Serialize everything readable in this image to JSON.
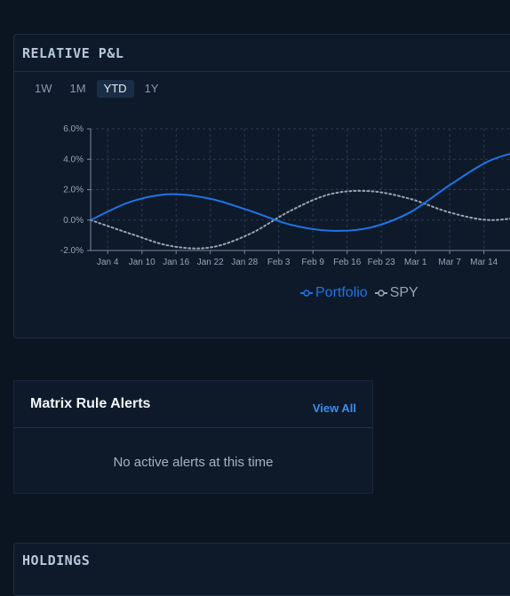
{
  "pnl": {
    "title": "RELATIVE P&L",
    "ranges": [
      {
        "label": "1W",
        "active": false
      },
      {
        "label": "1M",
        "active": false
      },
      {
        "label": "YTD",
        "active": true
      },
      {
        "label": "1Y",
        "active": false
      }
    ]
  },
  "chart_data": {
    "type": "line",
    "title": "",
    "xlabel": "",
    "ylabel": "",
    "x": [
      "2023-01-01",
      "2023-01-08",
      "2023-01-15",
      "2023-01-22",
      "2023-01-29",
      "2023-02-05",
      "2023-02-12",
      "2023-02-19",
      "2023-02-26",
      "2023-03-05",
      "2023-03-12",
      "2023-03-19"
    ],
    "x_tick_labels": [
      "Jan 4",
      "Jan 10",
      "Jan 16",
      "Jan 22",
      "Jan 28",
      "Feb 3",
      "Feb 9",
      "Feb 16",
      "Feb 23",
      "Mar 1",
      "Mar 7",
      "Mar 14"
    ],
    "y_tick_labels": [
      "-2.0%",
      "0.0%",
      "2.0%",
      "4.0%",
      "6.0%"
    ],
    "ylim": [
      -2,
      6
    ],
    "grid": true,
    "legend_position": "bottom",
    "series": [
      {
        "name": "Portfolio",
        "color": "#1f74e6",
        "style": "solid",
        "values": [
          0.0,
          1.2,
          1.7,
          1.4,
          0.6,
          -0.3,
          -0.7,
          -0.5,
          0.5,
          2.3,
          3.9,
          4.7
        ]
      },
      {
        "name": "SPY",
        "color": "#9aa4b1",
        "style": "dotted",
        "values": [
          0.0,
          -0.9,
          -1.7,
          -1.8,
          -0.9,
          0.6,
          1.7,
          1.9,
          1.4,
          0.5,
          0.0,
          0.3
        ]
      }
    ]
  },
  "alerts": {
    "title": "Matrix Rule Alerts",
    "view_all": "View All",
    "empty_message": "No active alerts at this time"
  },
  "holdings": {
    "title": "HOLDINGS"
  }
}
